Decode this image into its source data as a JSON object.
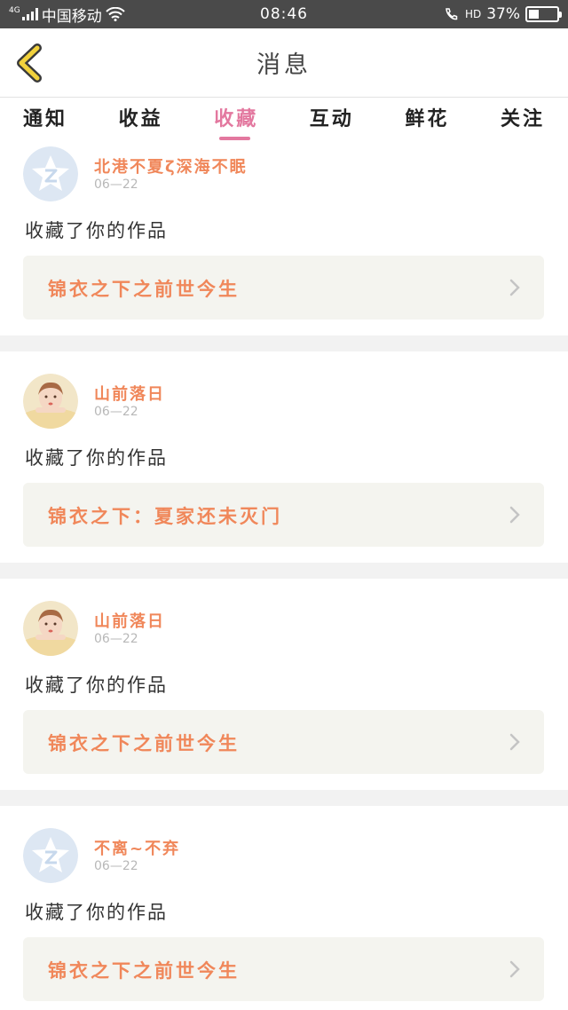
{
  "status_bar": {
    "network_type": "4G",
    "carrier": "中国移动",
    "time": "08:46",
    "hd": "HD",
    "battery_percent_text": "37%",
    "battery_level": 0.37
  },
  "header": {
    "title": "消息",
    "back_icon": "chevron-left-icon"
  },
  "tabs": [
    {
      "label": "通知",
      "active": false
    },
    {
      "label": "收益",
      "active": false
    },
    {
      "label": "收藏",
      "active": true
    },
    {
      "label": "互动",
      "active": false
    },
    {
      "label": "鲜花",
      "active": false
    },
    {
      "label": "关注",
      "active": false
    }
  ],
  "colors": {
    "accent_pink": "#e3789f",
    "orange_text": "#f0875a",
    "status_bar_bg": "#4a4a4a"
  },
  "items": [
    {
      "username": "北港不夏ζ深海不眠",
      "date": "06—22",
      "action": "收藏了你的作品",
      "work_title": "锦衣之下之前世今生",
      "avatar": "default-qq-avatar"
    },
    {
      "username": "山前落日",
      "date": "06—22",
      "action": "收藏了你的作品",
      "work_title": "锦衣之下：夏家还未灭门",
      "avatar": "girl-photo-avatar"
    },
    {
      "username": "山前落日",
      "date": "06—22",
      "action": "收藏了你的作品",
      "work_title": "锦衣之下之前世今生",
      "avatar": "girl-photo-avatar"
    },
    {
      "username": "不离~不弃",
      "date": "06—22",
      "action": "收藏了你的作品",
      "work_title": "锦衣之下之前世今生",
      "avatar": "default-qq-avatar"
    }
  ]
}
